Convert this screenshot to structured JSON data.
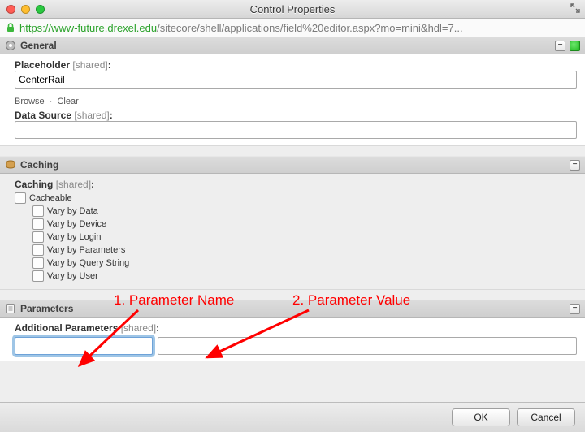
{
  "window": {
    "title": "Control Properties"
  },
  "url": {
    "scheme": "https",
    "host": "www-future.drexel.edu",
    "path": "/sitecore/shell/applications/field%20editor.aspx?mo=mini&hdl=7..."
  },
  "sections": {
    "general": {
      "title": "General",
      "placeholder_label": "Placeholder",
      "placeholder_shared": "[shared]",
      "placeholder_value": "CenterRail",
      "browse_link": "Browse",
      "clear_link": "Clear",
      "data_source_label": "Data Source",
      "data_source_shared": "[shared]",
      "data_source_value": ""
    },
    "caching": {
      "title": "Caching",
      "label": "Caching",
      "shared": "[shared]",
      "options": {
        "cacheable": "Cacheable",
        "vary_data": "Vary by Data",
        "vary_device": "Vary by Device",
        "vary_login": "Vary by Login",
        "vary_parameters": "Vary by Parameters",
        "vary_query_string": "Vary by Query String",
        "vary_user": "Vary by User"
      }
    },
    "parameters": {
      "title": "Parameters",
      "additional_label": "Additional Parameters",
      "additional_shared": "[shared]",
      "key_value": "",
      "val_value": ""
    }
  },
  "annotations": {
    "param_name": "1. Parameter Name",
    "param_value": "2. Parameter Value"
  },
  "footer": {
    "ok": "OK",
    "cancel": "Cancel"
  },
  "glyphs": {
    "minus": "−"
  }
}
